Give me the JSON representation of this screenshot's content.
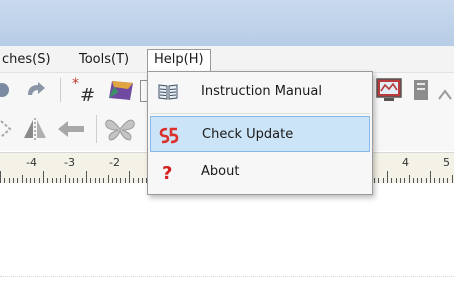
{
  "menubar": {
    "items": [
      {
        "label": "ches(S)"
      },
      {
        "label": "Tools(T)"
      },
      {
        "label": "Help(H)"
      }
    ]
  },
  "ruler": {
    "labels": [
      "-4",
      "-3",
      "-2",
      "4",
      "5"
    ]
  },
  "help_menu": {
    "items": [
      {
        "label": "Instruction Manual",
        "icon": "book-icon"
      },
      {
        "label": "Check Update",
        "icon": "update-icon",
        "highlighted": true
      },
      {
        "label": "About",
        "icon": "question-icon"
      }
    ]
  },
  "colors": {
    "titlebar": "#c2d5ec",
    "highlight": "#cce4f7",
    "highlight_border": "#86b9e6",
    "update_icon": "#d9332b",
    "question_icon": "#d42020"
  }
}
